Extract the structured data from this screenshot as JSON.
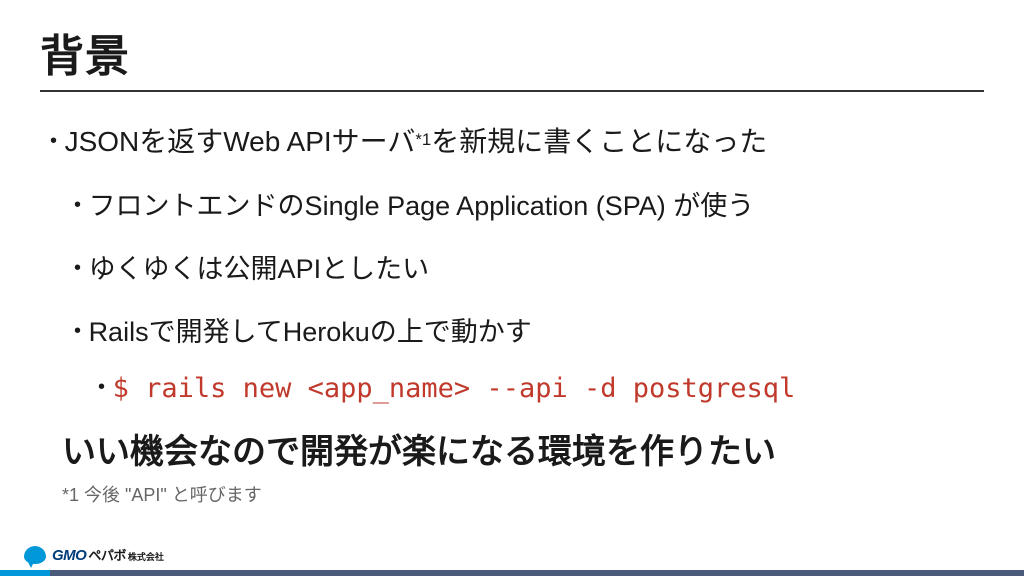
{
  "title": "背景",
  "bullets": {
    "b1_pre": "JSONを返すWeb APIサーバ",
    "b1_sup": "*1",
    "b1_post": "を新規に書くことになった",
    "b2": "フロントエンドのSingle Page Application (SPA) が使う",
    "b3": "ゆくゆくは公開APIとしたい",
    "b4": "Railsで開発してHerokuの上で動かす",
    "b5_code": "$ rails new <app_name> --api -d postgresql"
  },
  "emphasis": "いい機会なので開発が楽になる環境を作りたい",
  "footnote": "*1 今後 \"API\" と呼びます",
  "logo": {
    "gmo": "GMO",
    "pepabo": "ペパボ",
    "kk": "株式会社"
  }
}
